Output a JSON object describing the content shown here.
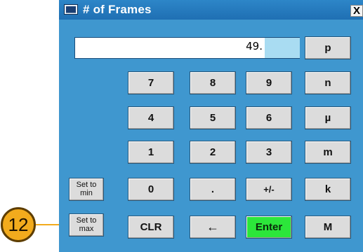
{
  "window": {
    "title": "# of Frames",
    "close_label": "X"
  },
  "display": {
    "value": "49."
  },
  "keys": {
    "p": "p",
    "n": "n",
    "mu": "µ",
    "m": "m",
    "k": "k",
    "M": "M",
    "d7": "7",
    "d8": "8",
    "d9": "9",
    "d4": "4",
    "d5": "5",
    "d6": "6",
    "d1": "1",
    "d2": "2",
    "d3": "3",
    "d0": "0",
    "dot": ".",
    "plusminus": "+/-",
    "clr": "CLR",
    "back": "←",
    "enter": "Enter",
    "set_min_line1": "Set to",
    "set_min_line2": "min",
    "set_max_line1": "Set to",
    "set_max_line2": "max"
  },
  "callout": {
    "number": "12"
  },
  "colors": {
    "window_bg": "#3f97cf",
    "enter_key": "#2ce63a",
    "callout": "#f2ab1d"
  }
}
